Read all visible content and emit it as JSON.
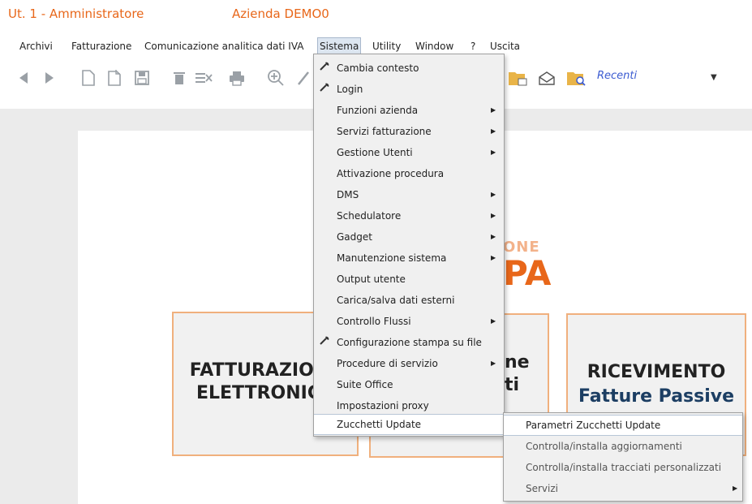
{
  "title": {
    "user": "Ut. 1 - Amministratore",
    "company": "Azienda DEMO0"
  },
  "menubar": {
    "items": [
      "Archivi",
      "Fatturazione",
      "Comunicazione analitica dati IVA",
      "Sistema",
      "Utility",
      "Window",
      "?",
      "Uscita"
    ]
  },
  "toolbar": {
    "recent_label": "Recenti"
  },
  "sistema_menu": {
    "items": [
      {
        "label": "Cambia contesto",
        "icon": "wrench-icon",
        "submenu": false
      },
      {
        "label": "Login",
        "icon": "wrench-icon",
        "submenu": false
      },
      {
        "label": "Funzioni azienda",
        "submenu": true
      },
      {
        "label": "Servizi fatturazione",
        "submenu": true
      },
      {
        "label": "Gestione Utenti",
        "submenu": true
      },
      {
        "label": "Attivazione procedura",
        "submenu": false
      },
      {
        "label": "DMS",
        "submenu": true
      },
      {
        "label": "Schedulatore",
        "submenu": true
      },
      {
        "label": "Gadget",
        "submenu": true
      },
      {
        "label": "Manutenzione sistema",
        "submenu": true
      },
      {
        "label": "Output utente",
        "submenu": false
      },
      {
        "label": "Carica/salva dati esterni",
        "submenu": false
      },
      {
        "label": "Controllo Flussi",
        "submenu": true
      },
      {
        "label": "Configurazione stampa su file",
        "icon": "wrench-icon",
        "submenu": false
      },
      {
        "label": "Procedure di servizio",
        "submenu": true
      },
      {
        "label": "Suite Office",
        "submenu": false
      },
      {
        "label": "Impostazioni proxy",
        "submenu": false
      },
      {
        "label": "Zucchetti Update",
        "submenu": true,
        "highlighted": true
      }
    ]
  },
  "update_submenu": {
    "items": [
      {
        "label": "Parametri Zucchetti Update",
        "highlighted": true
      },
      {
        "label": "Controlla/installa aggiornamenti"
      },
      {
        "label": "Controlla/installa tracciati personalizzati"
      },
      {
        "label": "Servizi",
        "submenu": true
      }
    ]
  },
  "dashboard": {
    "card1": {
      "line1": "FATTURAZIONE",
      "line2": "ELETTRONICA"
    },
    "card2": {
      "line1": "ne",
      "line2": "ti"
    },
    "card3": {
      "line1": "RICEVIMENTO",
      "line2": "Fatture Passive"
    },
    "logo": {
      "top": "ONE",
      "bottom": "PA"
    }
  },
  "colors": {
    "accent": "#e8671a",
    "card_border": "#f0b07d"
  }
}
